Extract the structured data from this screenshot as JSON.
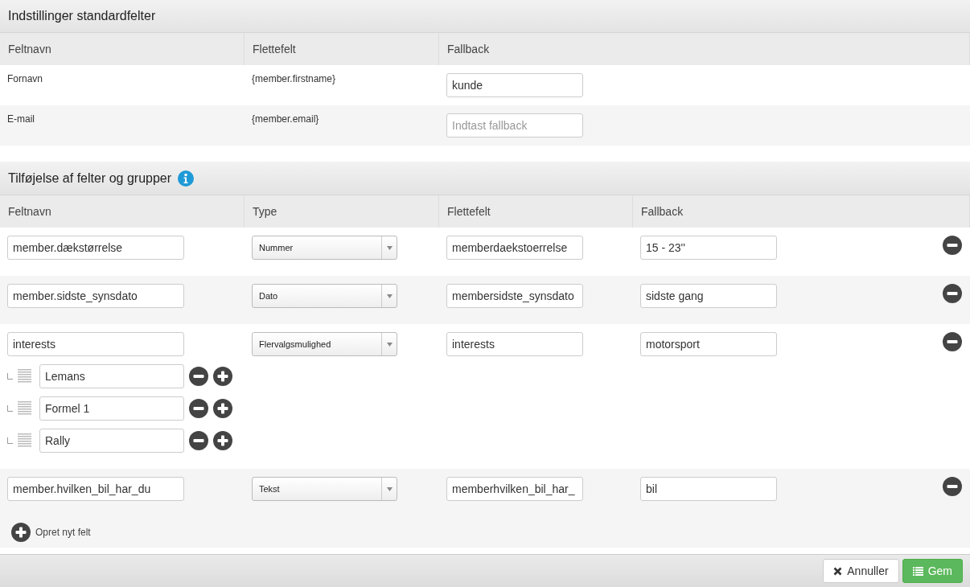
{
  "standard_fields": {
    "title": "Indstillinger standardfelter",
    "columns": [
      "Feltnavn",
      "Flettefelt",
      "Fallback"
    ],
    "rows": [
      {
        "field_name": "Fornavn",
        "merge_field": "{member.firstname}",
        "fallback": {
          "value": "kunde"
        }
      },
      {
        "field_name": "E-mail",
        "merge_field": "{member.email}",
        "fallback": {
          "placeholder": "Indtast fallback"
        }
      }
    ]
  },
  "custom_fields": {
    "title": "Tilføjelse af felter og grupper",
    "columns": [
      "Feltnavn",
      "Type",
      "Flettefelt",
      "Fallback"
    ],
    "rows": [
      {
        "name": "member.dækstørrelse",
        "type": "Nummer",
        "merge_field": "memberdaekstoerrelse",
        "fallback": "15 - 23''"
      },
      {
        "name": "member.sidste_synsdato",
        "type": "Dato",
        "merge_field": "membersidste_synsdato",
        "fallback": "sidste gang"
      },
      {
        "name": "interests",
        "type": "Flervalgsmulighed",
        "merge_field": "interests",
        "fallback": "motorsport",
        "options": [
          "Lemans",
          "Formel 1",
          "Rally"
        ]
      },
      {
        "name": "member.hvilken_bil_har_du",
        "type": "Tekst",
        "merge_field": "memberhvilken_bil_har_",
        "fallback": "bil"
      }
    ]
  },
  "add_field": {
    "label": "Opret nyt felt"
  },
  "footer": {
    "buttons": [
      {
        "label": "Annuller",
        "kind": "cancel"
      },
      {
        "label": "Gem",
        "kind": "save"
      }
    ]
  }
}
